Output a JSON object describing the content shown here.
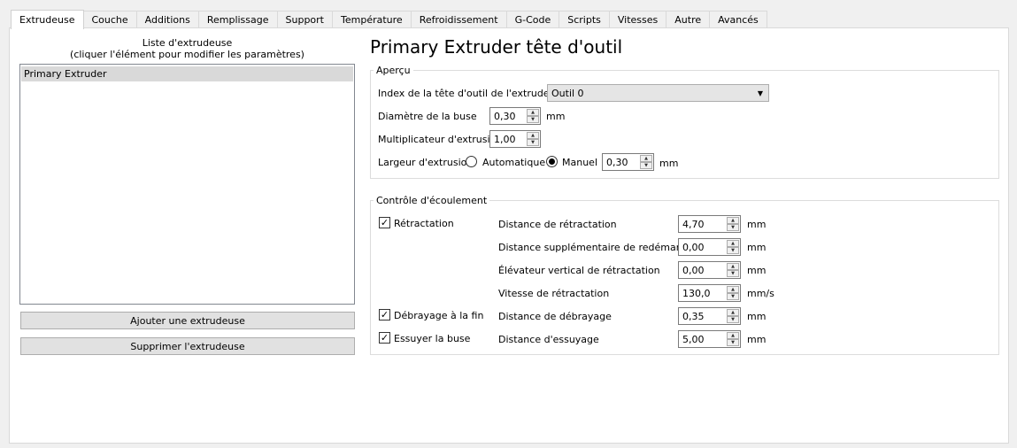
{
  "tabs": [
    "Extrudeuse",
    "Couche",
    "Additions",
    "Remplissage",
    "Support",
    "Température",
    "Refroidissement",
    "G-Code",
    "Scripts",
    "Vitesses",
    "Autre",
    "Avancés"
  ],
  "active_tab": "Extrudeuse",
  "left": {
    "list_title_line1": "Liste d'extrudeuse",
    "list_title_line2": "(cliquer l'élément pour modifier les paramètres)",
    "items": [
      "Primary Extruder"
    ],
    "add_button": "Ajouter une extrudeuse",
    "remove_button": "Supprimer l'extrudeuse"
  },
  "main": {
    "title": "Primary Extruder tête d'outil",
    "overview": {
      "group_label": "Aperçu",
      "tool_index_label": "Index de la tête d'outil de l'extrudeuse",
      "tool_index_value": "Outil 0",
      "nozzle_label": "Diamètre de la buse",
      "nozzle_value": "0,30",
      "nozzle_unit": "mm",
      "multiplier_label": "Multiplicateur d'extrusion",
      "multiplier_value": "1,00",
      "width_label": "Largeur d'extrusion",
      "auto_label": "Automatique",
      "manual_label": "Manuel",
      "width_value": "0,30",
      "width_unit": "mm"
    },
    "flow": {
      "group_label": "Contrôle d'écoulement",
      "retraction_check": "Rétractation",
      "coast_check": "Débrayage à la fin",
      "wipe_check": "Essuyer la buse",
      "retraction_distance_label": "Distance de rétractation",
      "retraction_distance_value": "4,70",
      "extra_restart_label": "Distance supplémentaire de redémarrage",
      "extra_restart_value": "0,00",
      "vertical_lift_label": "Élévateur vertical de rétractation",
      "vertical_lift_value": "0,00",
      "retraction_speed_label": "Vitesse de rétractation",
      "retraction_speed_value": "130,0",
      "coast_distance_label": "Distance de débrayage",
      "coast_distance_value": "0,35",
      "wipe_distance_label": "Distance d'essuyage",
      "wipe_distance_value": "5,00",
      "unit_mm": "mm",
      "unit_mms": "mm/s"
    }
  }
}
